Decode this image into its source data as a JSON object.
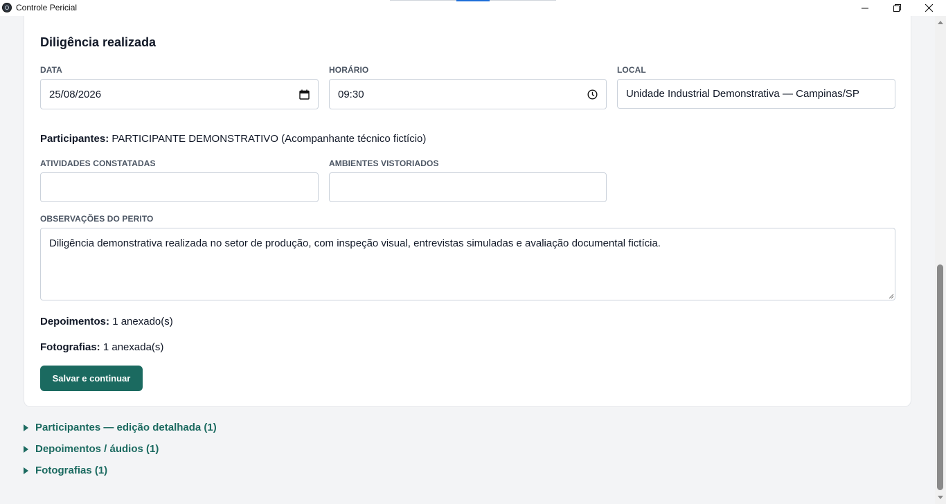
{
  "window": {
    "title": "Controle Pericial"
  },
  "form": {
    "title": "Diligência realizada",
    "data_label": "DATA",
    "data_value": "25/08/2026",
    "horario_label": "HORÁRIO",
    "horario_value": "09:30",
    "local_label": "LOCAL",
    "local_value": "Unidade Industrial Demonstrativa — Campinas/SP",
    "participantes_label": "Participantes:",
    "participantes_value": "PARTICIPANTE DEMONSTRATIVO (Acompanhante técnico fictício)",
    "atividades_label": "ATIVIDADES CONSTATADAS",
    "atividades_value": "",
    "ambientes_label": "AMBIENTES VISTORIADOS",
    "ambientes_value": "",
    "observacoes_label": "OBSERVAÇÕES DO PERITO",
    "observacoes_value": "Diligência demonstrativa realizada no setor de produção, com inspeção visual, entrevistas simuladas e avaliação documental fictícia.",
    "depoimentos_label": "Depoimentos:",
    "depoimentos_value": "1 anexado(s)",
    "fotografias_label": "Fotografias:",
    "fotografias_value": "1 anexada(s)",
    "save_button": "Salvar e continuar"
  },
  "sections": [
    {
      "label": "Participantes — edição detalhada (1)"
    },
    {
      "label": "Depoimentos / áudios (1)"
    },
    {
      "label": "Fotografias (1)"
    }
  ],
  "icons": {
    "app": "app-icon",
    "calendar": "calendar-icon",
    "clock": "clock-icon",
    "section_toggle": "triangle-right-icon"
  },
  "colors": {
    "accent": "#1b6a60",
    "background": "#f3f4f6",
    "card": "#ffffff"
  }
}
